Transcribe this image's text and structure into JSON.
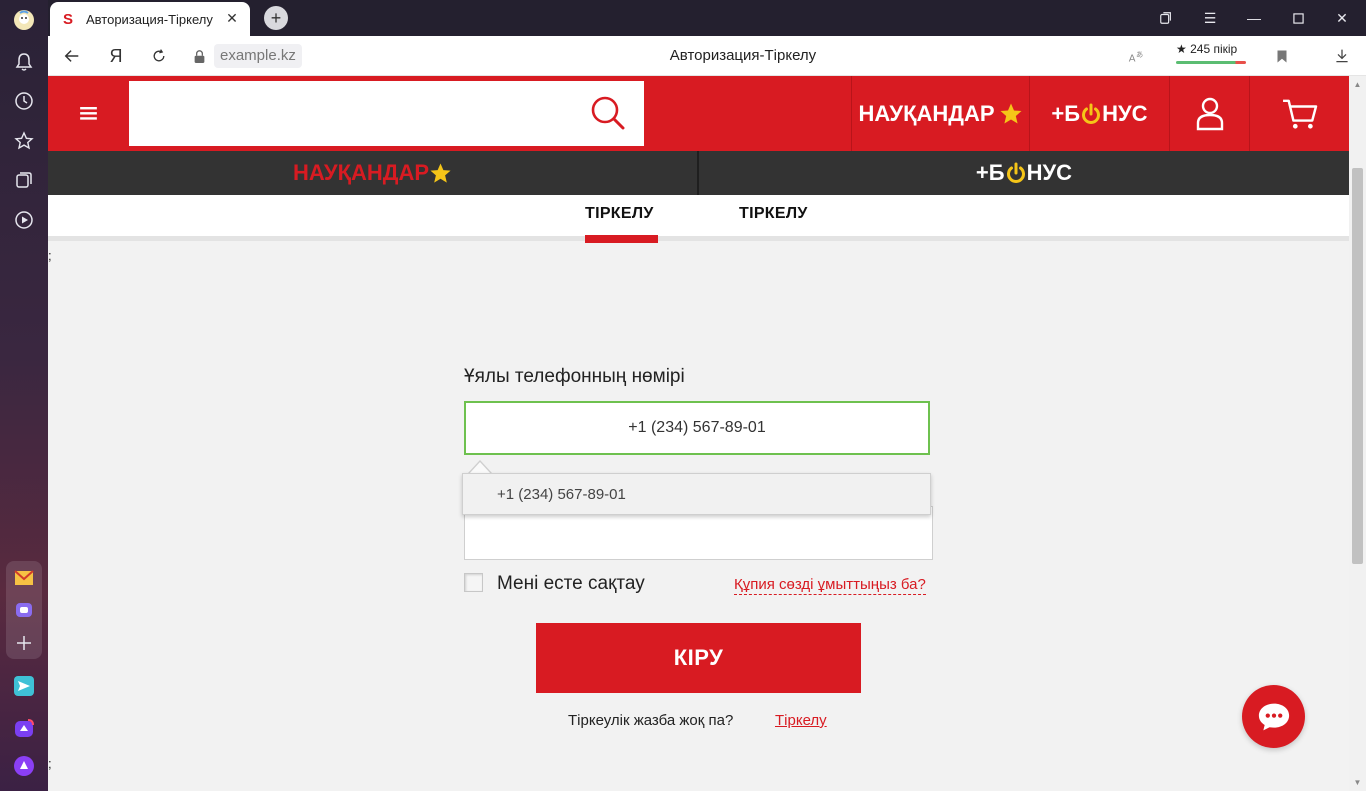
{
  "browser": {
    "tab_title": "Авторизация-Тіркелу",
    "tab_favicon": "S",
    "url": "example.kz",
    "page_title": "Авторизация-Тіркелу",
    "rating": "★ 245 пікір",
    "yandex_glyph": "Я"
  },
  "header": {
    "campaigns_label": "НАУҚАНДАР",
    "bonus_label_pre": "+Б",
    "bonus_label_post": "НУС"
  },
  "subnav": {
    "campaigns_label": "НАУҚАНДАР",
    "bonus_label_pre": "+Б",
    "bonus_label_post": "НУС"
  },
  "tabs": [
    {
      "label": "ТІРКЕЛУ",
      "active": true
    },
    {
      "label": "ТІРКЕЛУ",
      "active": false
    }
  ],
  "stray_text": {
    "top": ";",
    "bottom": ";"
  },
  "form": {
    "phone_label": "Ұялы телефонның нөмірі",
    "phone_value": "+1 (234) 567-89-01",
    "autofill_suggestion": "+1 (234) 567-89-01",
    "password_value": "",
    "remember_label": "Мені есте сақтау",
    "forgot_label": "Құпия сөзді ұмыттыңыз ба?",
    "login_button": "КІРУ",
    "no_account_text": "Тіркеулік жазба жоқ па?",
    "register_link": "Тіркелу"
  },
  "colors": {
    "brand_red": "#d81b22",
    "dark_bar": "#333333",
    "input_focus_green": "#6ec14f",
    "star_yellow": "#f5c518"
  }
}
